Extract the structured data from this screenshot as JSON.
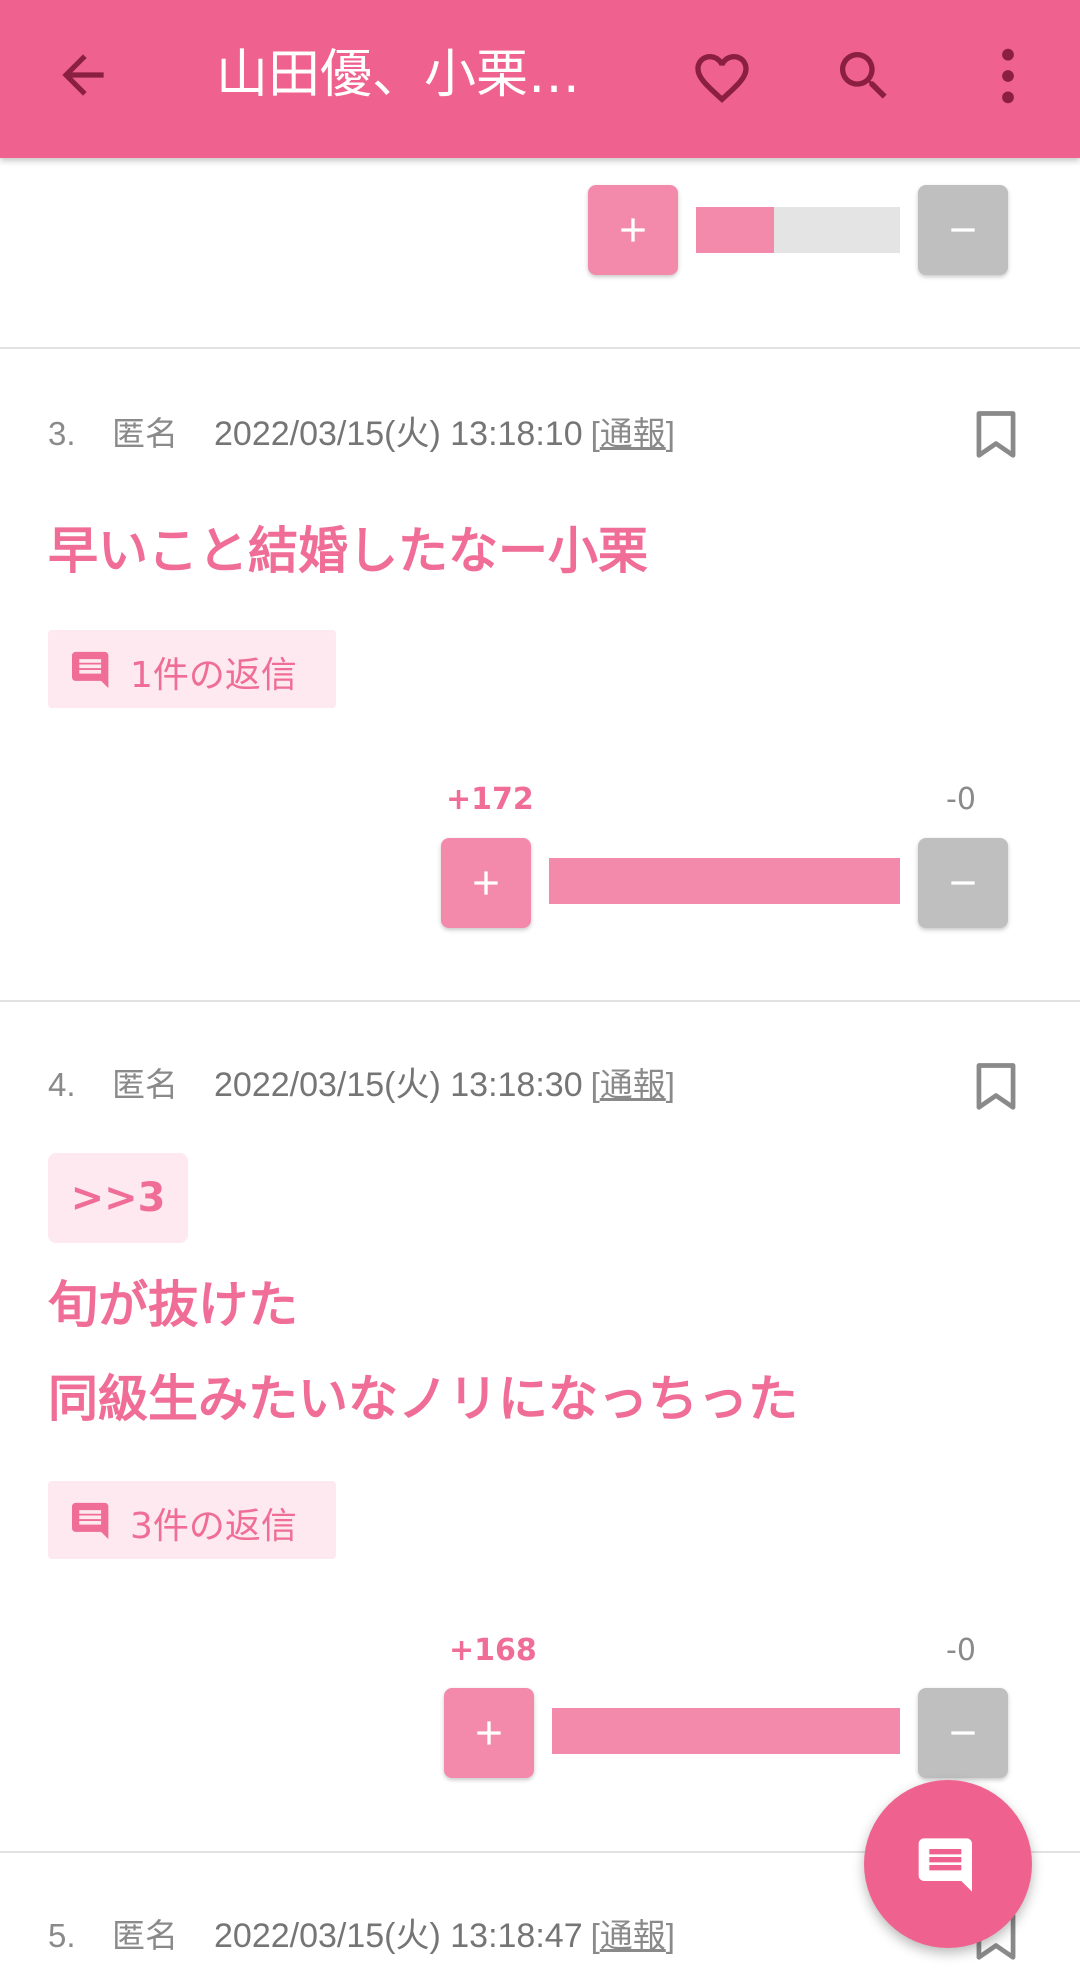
{
  "app_bar": {
    "title": "山田優、小栗…",
    "icons": [
      "back-arrow-icon",
      "heart-icon",
      "search-icon",
      "more-vert-icon"
    ]
  },
  "colors": {
    "primary": "#ef628f",
    "plus": "#f48aab",
    "minus": "#bfbfbf",
    "text_accent": "#ef6d97",
    "chip_bg": "#fde9ef"
  },
  "comments": [
    {
      "vote": {
        "plus_ratio": 0.38
      }
    },
    {
      "number": "3.",
      "name": "匿名",
      "datetime": "2022/03/15(火) 13:18:10",
      "report_open": "[",
      "report_label": "通報",
      "report_close": "]",
      "lines": [
        "早いこと結婚したなー小栗"
      ],
      "replies": "1件の返信",
      "vote": {
        "plus": "+172",
        "minus": "-0",
        "plus_ratio": 1.0
      }
    },
    {
      "number": "4.",
      "name": "匿名",
      "datetime": "2022/03/15(火) 13:18:30",
      "report_open": "[",
      "report_label": "通報",
      "report_close": "]",
      "anchor": ">>3",
      "lines": [
        "旬が抜けた",
        "同級生みたいなノリになっちった"
      ],
      "replies": "3件の返信",
      "vote": {
        "plus": "+168",
        "minus": "-0",
        "plus_ratio": 1.0
      }
    },
    {
      "number": "5.",
      "name": "匿名",
      "datetime": "2022/03/15(火) 13:18:47",
      "report_open": "[",
      "report_label": "通報",
      "report_close": "]"
    }
  ],
  "fab": {
    "icon": "comment-icon"
  }
}
